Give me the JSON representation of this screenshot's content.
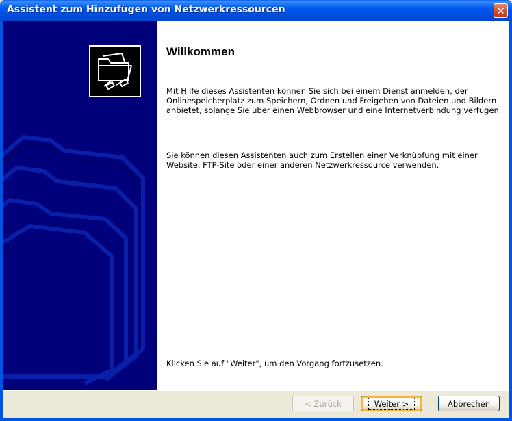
{
  "window": {
    "title": "Assistent zum Hinzufügen von Netzwerkressourcen",
    "close_glyph": "✕"
  },
  "content": {
    "heading": "Willkommen",
    "paragraph1": "Mit Hilfe dieses Assistenten können Sie sich bei einem Dienst anmelden, der Onlinespeicherplatz zum Speichern, Ordnen und Freigeben von Dateien und Bildern anbietet, solange Sie über einen Webbrowser und eine Internetverbindung verfügen.",
    "paragraph2": "Sie können diesen Assistenten auch zum Erstellen einer Verknüpfung mit einer Website, FTP-Site oder einer anderen Netzwerkressource verwenden.",
    "instruction": "Klicken Sie auf \"Weiter\", um den Vorgang fortzusetzen."
  },
  "buttons": {
    "back": "< Zurück",
    "next": "Weiter >",
    "cancel": "Abbrechen"
  },
  "icons": {
    "wizard": "network-folder-icon",
    "background": "folder-outline-watermark"
  },
  "colors": {
    "titlebar": "#0054e3",
    "left_panel": "#00007a",
    "close_button": "#d5532f",
    "default_button_highlight": "#f8b636"
  }
}
